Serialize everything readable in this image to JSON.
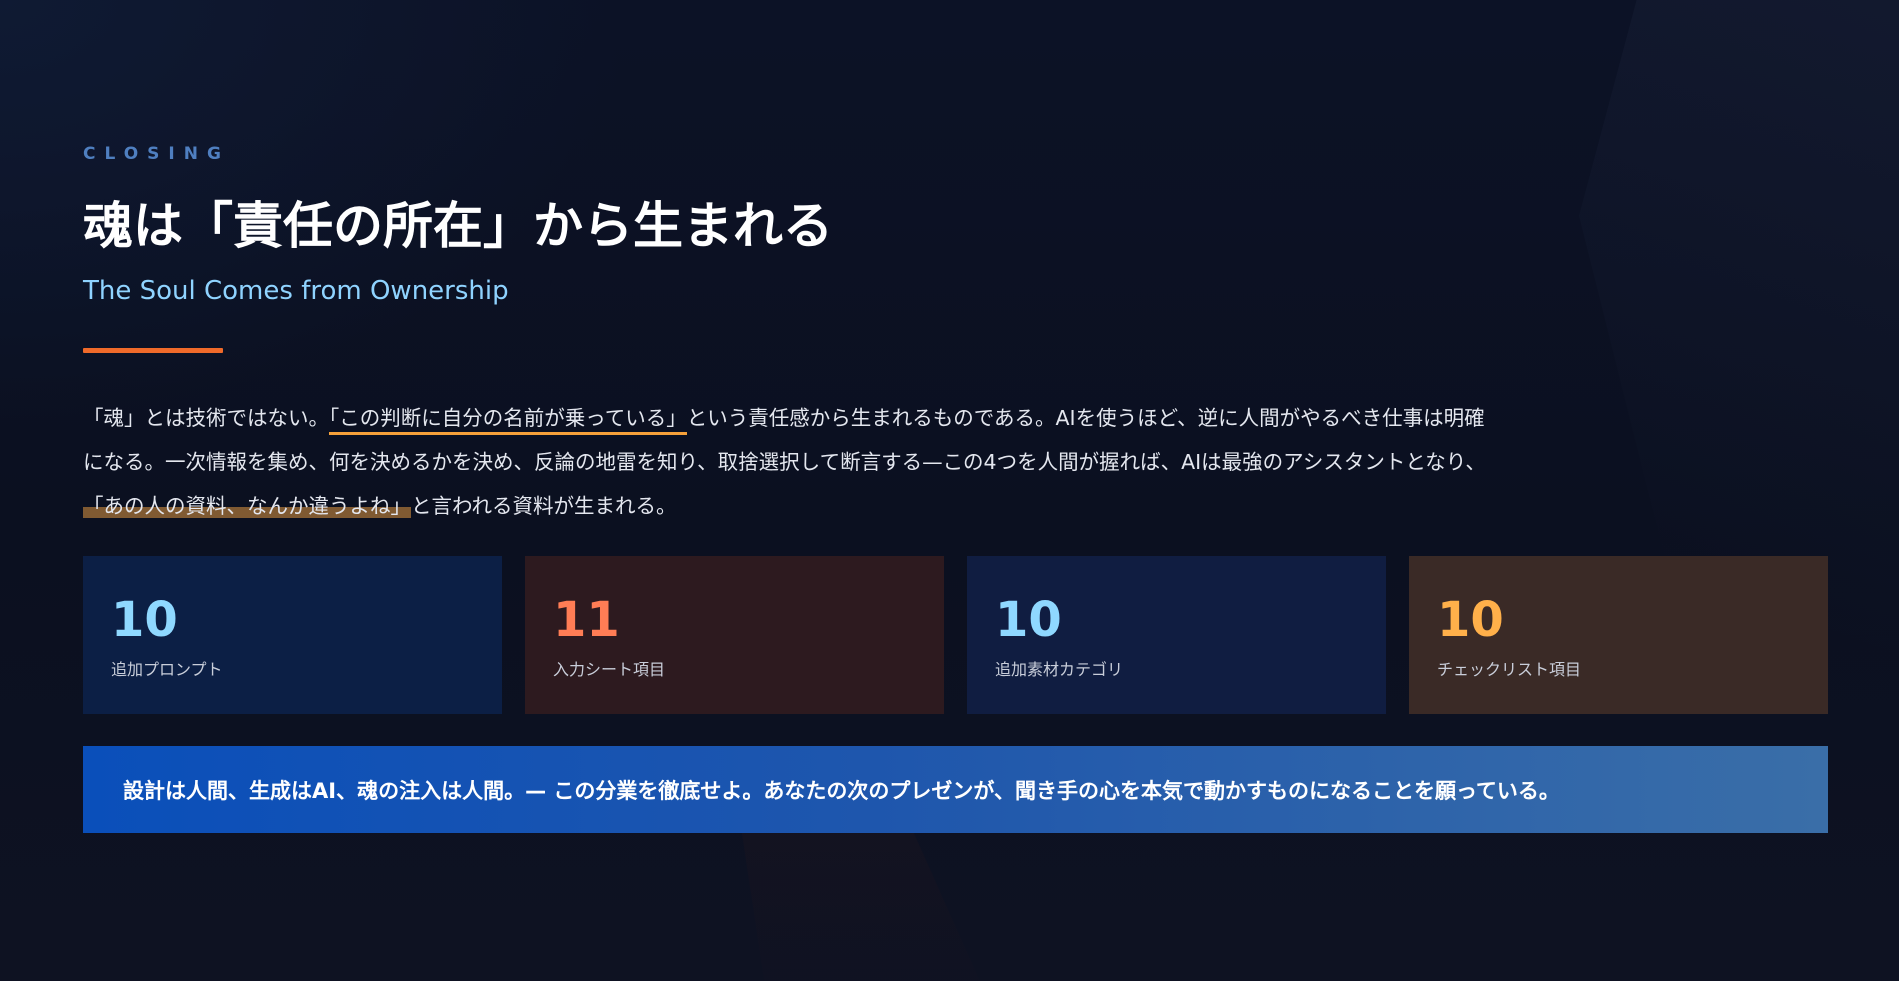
{
  "slide": {
    "eyebrow": "CLOSING",
    "title": "魂は「責任の所在」から生まれる",
    "subtitle": "The Soul Comes from Ownership",
    "body": {
      "part1": "「魂」とは技術ではない。",
      "highlight1": "「この判断に自分の名前が乗っている」",
      "part2": "という責任感から生まれるものである。AIを使うほど、逆に人間がやるべき仕事は明確になる。一次情報を集め、何を決めるかを決め、反論の地雷を知り、取捨選択して断言する—この4つを人間が握れば、AIは最強のアシスタントとなり、",
      "highlight2": "「あの人の資料、なんか違うよね」",
      "part3": "と言われる資料が生まれる。"
    },
    "stats": [
      {
        "value": "10",
        "label": "追加プロンプト",
        "color": "#8fd8ff"
      },
      {
        "value": "11",
        "label": "入力シート項目",
        "color": "#ff7d55"
      },
      {
        "value": "10",
        "label": "追加素材カテゴリ",
        "color": "#8fd8ff"
      },
      {
        "value": "10",
        "label": "チェックリスト項目",
        "color": "#ffb04a"
      }
    ],
    "banner": "設計は人間、生成はAI、魂の注入は人間。— この分業を徹底せよ。あなたの次のプレゼンが、聞き手の心を本気で動かすものになることを願っている。",
    "colors": {
      "accent_rule": "#f06a2a",
      "eyebrow": "#4f7fc0",
      "subtitle": "#8fd3ff",
      "underline": "#f5a03a",
      "marker": "#b27a3a",
      "banner_start": "#0a4fba",
      "banner_end": "#3a6ea8"
    }
  }
}
